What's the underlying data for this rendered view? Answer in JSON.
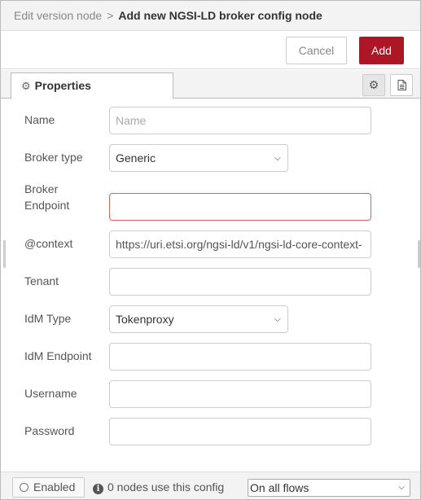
{
  "breadcrumb": {
    "parent": "Edit version node",
    "separator": ">",
    "current": "Add new NGSI-LD broker config node"
  },
  "toolbar": {
    "cancel_label": "Cancel",
    "add_label": "Add",
    "add_color": "#ad1625"
  },
  "tabs": {
    "properties_label": "Properties",
    "properties_icon": "gear-icon",
    "side_icons": [
      "gear-icon",
      "document-icon"
    ]
  },
  "form": {
    "name": {
      "label": "Name",
      "placeholder": "Name",
      "value": ""
    },
    "broker_type": {
      "label": "Broker type",
      "value": "Generic"
    },
    "broker_endpoint": {
      "label_line1": "Broker",
      "label_line2": "Endpoint",
      "value": "",
      "state": "error",
      "error_color": "#d6615f"
    },
    "context": {
      "label": "@context",
      "value": "https://uri.etsi.org/ngsi-ld/v1/ngsi-ld-core-context-"
    },
    "tenant": {
      "label": "Tenant",
      "value": ""
    },
    "idm_type": {
      "label": "IdM Type",
      "value": "Tokenproxy"
    },
    "idm_endpoint": {
      "label": "IdM Endpoint",
      "value": ""
    },
    "username": {
      "label": "Username",
      "value": ""
    },
    "password": {
      "label": "Password",
      "value": ""
    }
  },
  "footer": {
    "enabled_label": "Enabled",
    "usage_text": "0 nodes use this config",
    "scope_value": "On all flows"
  }
}
